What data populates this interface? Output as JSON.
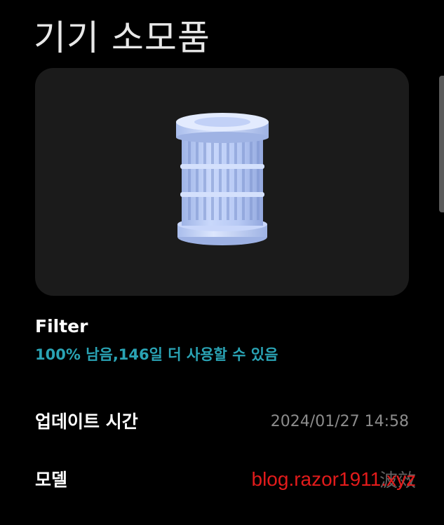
{
  "page": {
    "title": "기기 소모품"
  },
  "consumable": {
    "image_icon": "air-filter-cartridge-icon",
    "name": "Filter",
    "status": "100% 남음,146일 더 사용할 수 있음",
    "status_color": "#2aa3b4",
    "remaining_percent": 100
  },
  "info": {
    "update_label": "업데이트 시간",
    "update_value": "2024/01/27 14:58",
    "model_label": "모델",
    "model_overlay_text": "波效"
  },
  "watermark": {
    "text": "blog.razor1911.xyz",
    "color": "#e21b1b"
  },
  "colors": {
    "background": "#000000",
    "card": "#1b1b1b",
    "filter_body": "#b4c8f2"
  }
}
